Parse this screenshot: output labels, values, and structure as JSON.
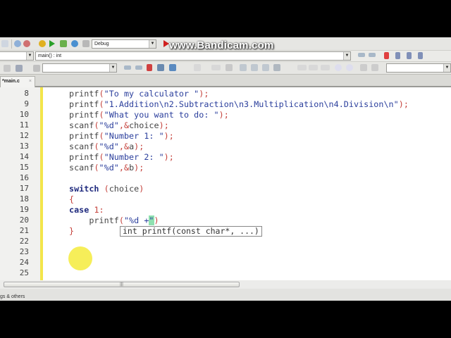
{
  "watermark": "www.Bandicam.com",
  "toolbar": {
    "config_combo": "Debug",
    "function_combo": "main() : int",
    "search_combo": ""
  },
  "tabs": [
    {
      "label": "*main.c",
      "close": "×"
    }
  ],
  "editor": {
    "lines": [
      {
        "num": "8",
        "tokens": [
          [
            "printf",
            "id"
          ],
          [
            "(",
            "op"
          ],
          [
            "\"To my calculator \"",
            "str"
          ],
          [
            ");",
            "op"
          ]
        ]
      },
      {
        "num": "9",
        "tokens": [
          [
            "printf",
            "id"
          ],
          [
            "(",
            "op"
          ],
          [
            "\"1.Addition\\n2.Subtraction\\n3.Multiplication\\n4.Division\\n\"",
            "str"
          ],
          [
            ");",
            "op"
          ]
        ]
      },
      {
        "num": "10",
        "tokens": [
          [
            "printf",
            "id"
          ],
          [
            "(",
            "op"
          ],
          [
            "\"What you want to do: \"",
            "str"
          ],
          [
            ");",
            "op"
          ]
        ]
      },
      {
        "num": "11",
        "tokens": [
          [
            "scanf",
            "id"
          ],
          [
            "(",
            "op"
          ],
          [
            "\"%d\"",
            "str"
          ],
          [
            ",&",
            "op"
          ],
          [
            "choice",
            "id"
          ],
          [
            ");",
            "op"
          ]
        ]
      },
      {
        "num": "12",
        "tokens": [
          [
            "printf",
            "id"
          ],
          [
            "(",
            "op"
          ],
          [
            "\"Number 1: \"",
            "str"
          ],
          [
            ");",
            "op"
          ]
        ]
      },
      {
        "num": "13",
        "tokens": [
          [
            "scanf",
            "id"
          ],
          [
            "(",
            "op"
          ],
          [
            "\"%d\"",
            "str"
          ],
          [
            ",&",
            "op"
          ],
          [
            "a",
            "id"
          ],
          [
            ");",
            "op"
          ]
        ]
      },
      {
        "num": "14",
        "tokens": [
          [
            "printf",
            "id"
          ],
          [
            "(",
            "op"
          ],
          [
            "\"Number 2: \"",
            "str"
          ],
          [
            ");",
            "op"
          ]
        ]
      },
      {
        "num": "15",
        "tokens": [
          [
            "scanf",
            "id"
          ],
          [
            "(",
            "op"
          ],
          [
            "\"%d\"",
            "str"
          ],
          [
            ",&",
            "op"
          ],
          [
            "b",
            "id"
          ],
          [
            ");",
            "op"
          ]
        ]
      },
      {
        "num": "16",
        "tokens": []
      },
      {
        "num": "17",
        "tokens": [
          [
            "switch",
            "kw"
          ],
          [
            " (",
            "op"
          ],
          [
            "choice",
            "id"
          ],
          [
            ")",
            "op"
          ]
        ]
      },
      {
        "num": "18",
        "tokens": [
          [
            "{",
            "op"
          ]
        ]
      },
      {
        "num": "19",
        "tokens": [
          [
            "case",
            "kw"
          ],
          [
            " ",
            "id"
          ],
          [
            "1",
            "num"
          ],
          [
            ":",
            "op"
          ]
        ]
      },
      {
        "num": "20",
        "tokens": [
          [
            "    printf",
            "id"
          ],
          [
            "(",
            "op"
          ],
          [
            "\"%d +",
            "str"
          ],
          [
            "\"",
            "caret str"
          ],
          [
            ")",
            "op"
          ]
        ]
      },
      {
        "num": "21",
        "tokens": [
          [
            "}",
            "op"
          ]
        ]
      },
      {
        "num": "22",
        "tokens": []
      },
      {
        "num": "23",
        "tokens": []
      },
      {
        "num": "24",
        "tokens": []
      },
      {
        "num": "25",
        "tokens": []
      }
    ],
    "tooltip": "int printf(const char*, ...)"
  },
  "status": {
    "text": "gs & others"
  }
}
